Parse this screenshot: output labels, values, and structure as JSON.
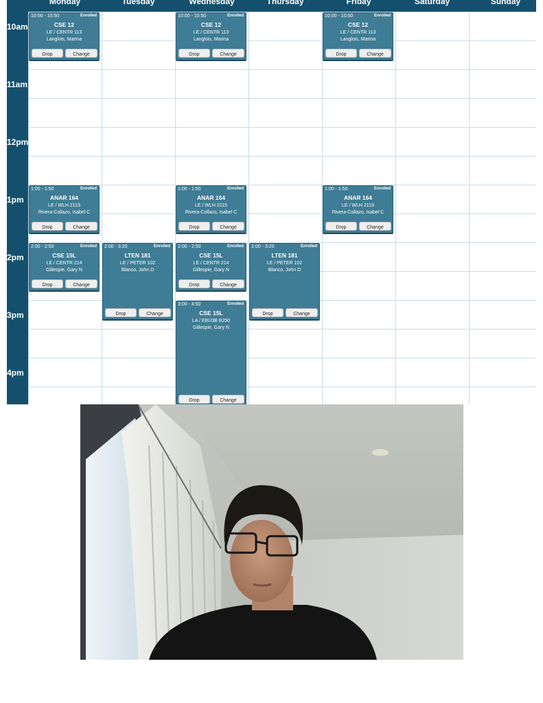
{
  "calendar": {
    "days": [
      "Monday",
      "Tuesday",
      "Wednesday",
      "Thursday",
      "Friday",
      "Saturday",
      "Sunday"
    ],
    "times": [
      "10am",
      "11am",
      "12pm",
      "1pm",
      "2pm",
      "3pm",
      "4pm"
    ],
    "events": [
      {
        "day": 0,
        "start": 10.0,
        "end": 10.833,
        "time": "10:00 - 10:50",
        "status": "Enrolled",
        "course": "CSE 12",
        "location": "LE / CENTR 113",
        "instructor": "Langlois, Marina",
        "drop": "Drop",
        "change": "Change"
      },
      {
        "day": 2,
        "start": 10.0,
        "end": 10.833,
        "time": "10:00 - 10:50",
        "status": "Enrolled",
        "course": "CSE 12",
        "location": "LE / CENTR 113",
        "instructor": "Langlois, Marina",
        "drop": "Drop",
        "change": "Change"
      },
      {
        "day": 4,
        "start": 10.0,
        "end": 10.833,
        "time": "10:00 - 10:50",
        "status": "Enrolled",
        "course": "CSE 12",
        "location": "LE / CENTR 113",
        "instructor": "Langlois, Marina",
        "drop": "Drop",
        "change": "Change"
      },
      {
        "day": 0,
        "start": 13.0,
        "end": 13.833,
        "time": "1:00 - 1:50",
        "status": "Enrolled",
        "course": "ANAR 164",
        "location": "LE / WLH 2115",
        "instructor": "Rivera-Collazo, Isabel C",
        "drop": "Drop",
        "change": "Change"
      },
      {
        "day": 2,
        "start": 13.0,
        "end": 13.833,
        "time": "1:00 - 1:50",
        "status": "Enrolled",
        "course": "ANAR 164",
        "location": "LE / WLH 2115",
        "instructor": "Rivera-Collazo, Isabel C",
        "drop": "Drop",
        "change": "Change"
      },
      {
        "day": 4,
        "start": 13.0,
        "end": 13.833,
        "time": "1:00 - 1:50",
        "status": "Enrolled",
        "course": "ANAR 164",
        "location": "LE / WLH 2115",
        "instructor": "Rivera-Collazo, Isabel C",
        "drop": "Drop",
        "change": "Change"
      },
      {
        "day": 0,
        "start": 14.0,
        "end": 14.833,
        "time": "2:00 - 2:50",
        "status": "Enrolled",
        "course": "CSE 15L",
        "location": "LE / CENTR 214",
        "instructor": "Gillespie, Gary N",
        "drop": "Drop",
        "change": "Change"
      },
      {
        "day": 1,
        "start": 14.0,
        "end": 15.333,
        "time": "2:00 - 3:20",
        "status": "Enrolled",
        "course": "LTEN 181",
        "location": "LE / PETER 102",
        "instructor": "Blanco, John D",
        "drop": "Drop",
        "change": "Change"
      },
      {
        "day": 2,
        "start": 14.0,
        "end": 14.833,
        "time": "2:00 - 2:50",
        "status": "Enrolled",
        "course": "CSE 15L",
        "location": "LE / CENTR 214",
        "instructor": "Gillespie, Gary N",
        "drop": "Drop",
        "change": "Change"
      },
      {
        "day": 3,
        "start": 14.0,
        "end": 15.333,
        "time": "2:00 - 3:20",
        "status": "Enrolled",
        "course": "LTEN 181",
        "location": "LE / PETER 102",
        "instructor": "Blanco, John D",
        "drop": "Drop",
        "change": "Change"
      },
      {
        "day": 2,
        "start": 15.0,
        "end": 16.833,
        "time": "3:00 - 4:50",
        "status": "Enrolled",
        "course": "CSE 15L",
        "location": "LA / EBU3B B250",
        "instructor": "Gillespie, Gary N",
        "drop": "Drop",
        "change": "Change"
      }
    ]
  },
  "colors": {
    "header": "#14506e",
    "event": "#3f7c95",
    "grid": "#c9dcea"
  },
  "photo": {
    "subject": "webcam-photo"
  }
}
